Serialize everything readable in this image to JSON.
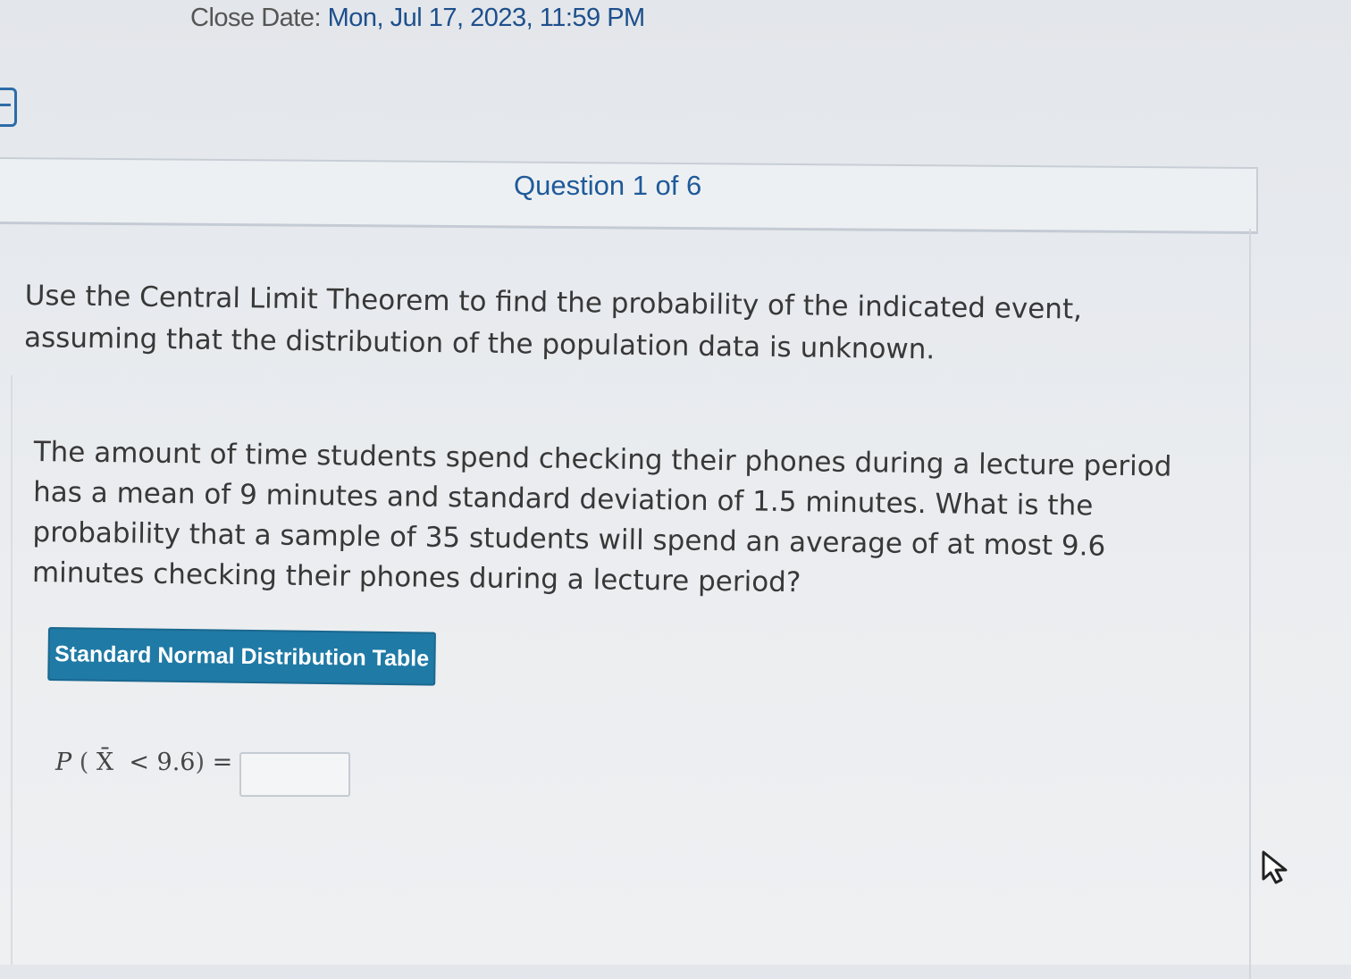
{
  "header": {
    "close_date_label": "Close Date:",
    "close_date_value": "Mon, Jul 17, 2023, 11:59 PM"
  },
  "question": {
    "title": "Question 1 of 6",
    "prompt": "Use the Central Limit Theorem to find the probability of the indicated event, assuming that the distribution of the population data is unknown.",
    "problem": "The amount of time students spend checking their phones during a lecture period has a mean of 9 minutes and standard deviation of 1.5 minutes. What is the probability that a sample of 35 students will spend an average of at most 9.6 minutes checking their phones during a lecture period?",
    "table_button_label": "Standard Normal Distribution Table",
    "formula": {
      "p": "P",
      "open": "(",
      "xbar": "X̄",
      "lt": "<",
      "value": "9.6",
      "close": ")",
      "equals": "="
    },
    "answer_value": ""
  },
  "colors": {
    "accent": "#1f7aa5",
    "title": "#1f5a99",
    "date": "#1d4f8c"
  }
}
